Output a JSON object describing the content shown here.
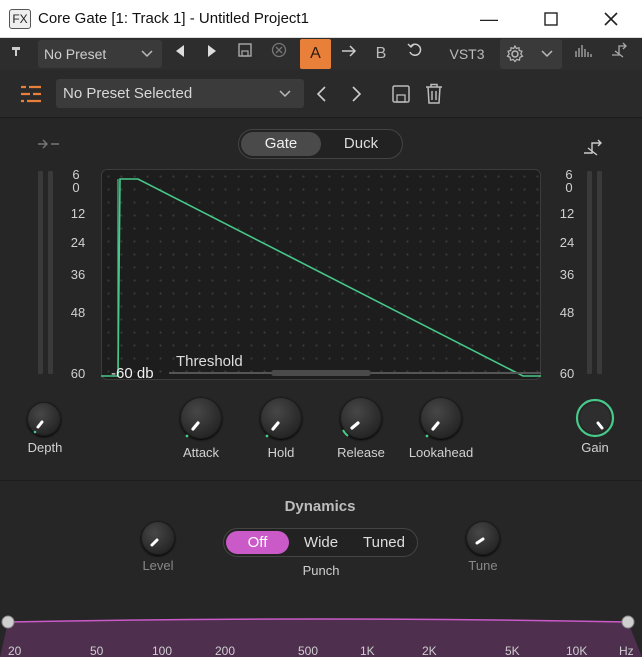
{
  "window": {
    "fx_badge": "FX",
    "title": "Core Gate [1: Track 1] - Untitled Project1",
    "minimize_icon": "minimize-icon",
    "maximize_icon": "maximize-icon",
    "close_icon": "close-icon"
  },
  "host_toolbar": {
    "preset": "No Preset",
    "compare_a": "A",
    "compare_b": "B",
    "format": "VST3",
    "accent_color": "#e8803a"
  },
  "preset_bar": {
    "preset_name": "No Preset Selected"
  },
  "mode": {
    "options": [
      "Gate",
      "Duck"
    ],
    "selected": "Gate"
  },
  "scale_left": [
    "6",
    "0",
    "12",
    "24",
    "36",
    "48",
    "60"
  ],
  "scale_right": [
    "6",
    "0",
    "12",
    "24",
    "36",
    "48",
    "60"
  ],
  "graph": {
    "threshold_label": "Threshold",
    "threshold_value": "-60 db",
    "curve_color": "#47c98a"
  },
  "knobs": {
    "depth": "Depth",
    "attack": "Attack",
    "hold": "Hold",
    "release": "Release",
    "lookahead": "Lookahead",
    "gain": "Gain"
  },
  "dynamics": {
    "title": "Dynamics",
    "level": "Level",
    "tune": "Tune",
    "punch_label": "Punch",
    "punch_options": [
      "Off",
      "Wide",
      "Tuned"
    ],
    "punch_selected": "Off",
    "punch_color": "#c95ac8"
  },
  "freq_axis": [
    "20",
    "50",
    "100",
    "200",
    "500",
    "1K",
    "2K",
    "5K",
    "10K",
    "Hz"
  ],
  "band_color": "#4e2f4e"
}
